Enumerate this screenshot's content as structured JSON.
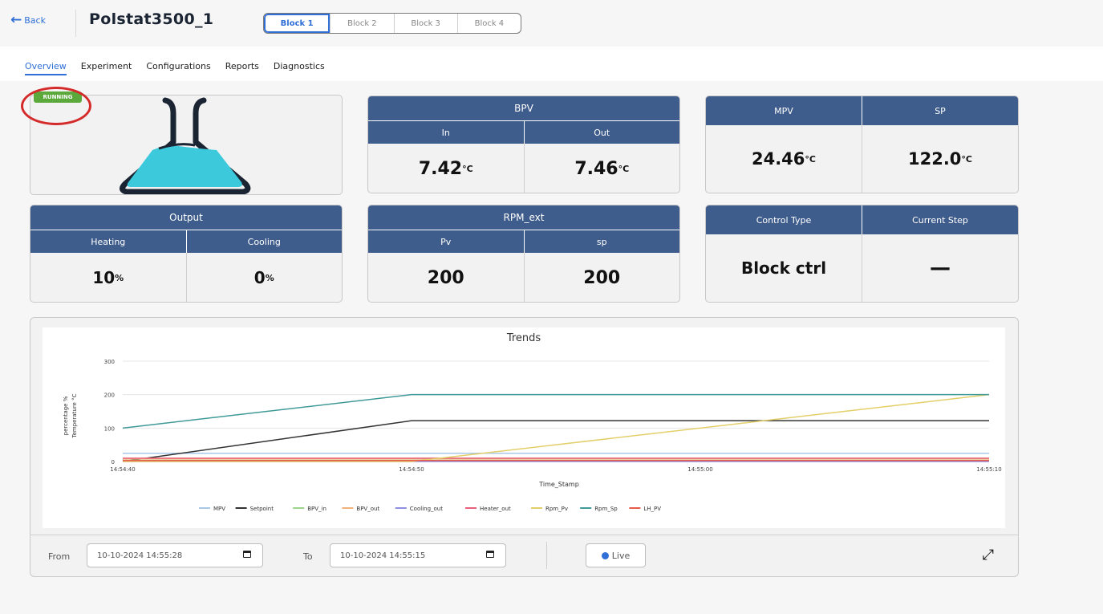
{
  "topbar": {
    "back_label": "Back",
    "title": "Polstat3500_1",
    "blocks": [
      "Block 1",
      "Block 2",
      "Block 3",
      "Block 4"
    ]
  },
  "tabs": [
    "Overview",
    "Experiment",
    "Configurations",
    "Reports",
    "Diagnostics"
  ],
  "status_badge": "RUNNING",
  "bpv": {
    "title": "BPV",
    "in_label": "In",
    "out_label": "Out",
    "in_value": "7.42",
    "out_value": "7.46",
    "unit": "°C"
  },
  "mpv_sp": {
    "mpv_label": "MPV",
    "sp_label": "SP",
    "mpv_value": "24.46",
    "sp_value": "122.0",
    "unit": "°C"
  },
  "output": {
    "title": "Output",
    "heating_label": "Heating",
    "cooling_label": "Cooling",
    "heating_value": "10",
    "cooling_value": "0",
    "unit": "%"
  },
  "rpm": {
    "title": "RPM_ext",
    "pv_label": "Pv",
    "sp_label": "sp",
    "pv_value": "200",
    "sp_value": "200"
  },
  "control": {
    "type_label": "Control Type",
    "step_label": "Current Step",
    "type_value": "Block ctrl",
    "step_value": "—"
  },
  "filters": {
    "from_label": "From",
    "from_value": "10-10-2024 14:55:28",
    "to_label": "To",
    "to_value": "10-10-2024 14:55:15",
    "live_label": "Live"
  },
  "chart_data": {
    "type": "line",
    "title": "Trends",
    "xlabel": "Time_Stamp",
    "ylabels": [
      "percentage %",
      "Temperature °C"
    ],
    "x": [
      "14:54:40",
      "14:54:50",
      "14:55:00",
      "14:55:10"
    ],
    "x_seconds": [
      0,
      10,
      20,
      30
    ],
    "ylim": [
      0,
      300
    ],
    "yticks": [
      0,
      100,
      200,
      300
    ],
    "grid": "horizontal",
    "legend": "bottom",
    "series": [
      {
        "name": "MPV",
        "color": "#a9c8e8",
        "points": [
          [
            0,
            24.46
          ],
          [
            30,
            24.46
          ]
        ]
      },
      {
        "name": "Setpoint",
        "color": "#333333",
        "points": [
          [
            0,
            0
          ],
          [
            10,
            122.0
          ],
          [
            30,
            122.0
          ]
        ]
      },
      {
        "name": "BPV_in",
        "color": "#9ad58a",
        "points": [
          [
            0,
            7.42
          ],
          [
            30,
            7.42
          ]
        ]
      },
      {
        "name": "BPV_out",
        "color": "#f0b27a",
        "points": [
          [
            0,
            7.46
          ],
          [
            30,
            7.46
          ]
        ]
      },
      {
        "name": "Cooling_out",
        "color": "#8f8ee0",
        "points": [
          [
            0,
            0
          ],
          [
            30,
            0
          ]
        ]
      },
      {
        "name": "Heater_out",
        "color": "#e8607a",
        "points": [
          [
            0,
            10
          ],
          [
            30,
            10
          ]
        ]
      },
      {
        "name": "Rpm_Pv",
        "color": "#e3cf6a",
        "points": [
          [
            0,
            0
          ],
          [
            10,
            0
          ],
          [
            30,
            200
          ]
        ]
      },
      {
        "name": "Rpm_Sp",
        "color": "#3f9a98",
        "points": [
          [
            0,
            100
          ],
          [
            10,
            200
          ],
          [
            30,
            200
          ]
        ]
      },
      {
        "name": "LH_PV",
        "color": "#e85a4a",
        "points": [
          [
            0,
            3
          ],
          [
            30,
            3
          ]
        ]
      }
    ]
  }
}
